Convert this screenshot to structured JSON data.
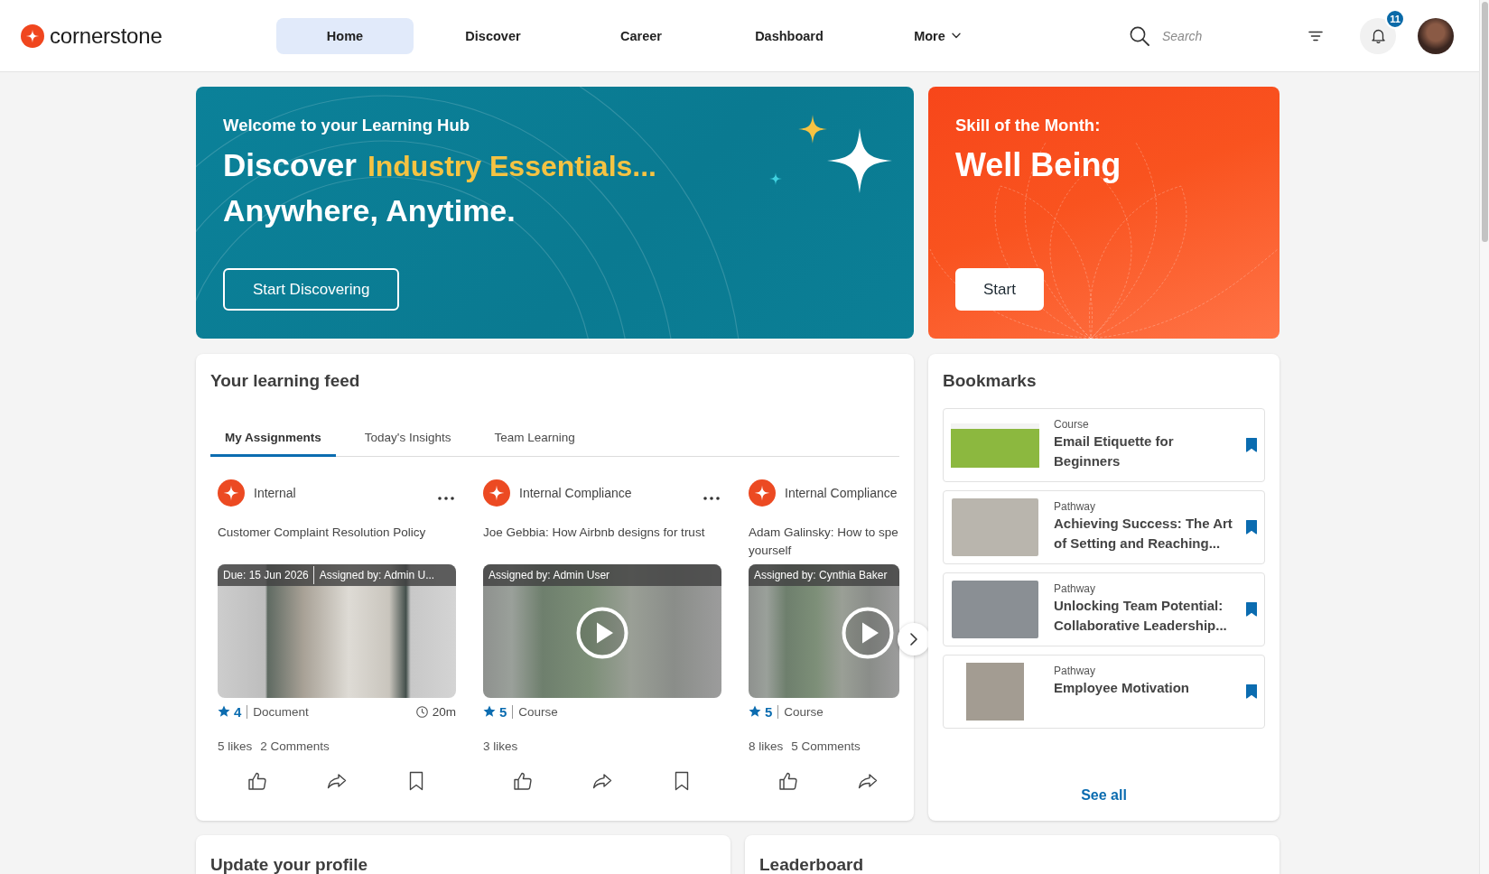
{
  "header": {
    "logo": "cornerstone",
    "nav": [
      {
        "label": "Home",
        "selected": true,
        "has_menu": false
      },
      {
        "label": "Discover",
        "selected": false,
        "has_menu": false
      },
      {
        "label": "Career",
        "selected": false,
        "has_menu": false
      },
      {
        "label": "Dashboard",
        "selected": false,
        "has_menu": false
      },
      {
        "label": "More",
        "selected": false,
        "has_menu": true
      }
    ],
    "search": {
      "placeholder": "Search"
    },
    "notifications": {
      "count": "11"
    }
  },
  "hero": {
    "welcome": {
      "eyebrow": "Welcome to your Learning Hub",
      "headline": "Discover",
      "highlight": "Industry Essentials...",
      "subline": "Anywhere, Anytime.",
      "button": "Start Discovering"
    },
    "skill": {
      "eyebrow": "Skill of the Month:",
      "title": "Well Being",
      "button": "Start"
    }
  },
  "feed": {
    "title": "Your learning feed",
    "tabs": [
      {
        "label": "My Assignments",
        "selected": true
      },
      {
        "label": "Today's Insights",
        "selected": false
      },
      {
        "label": "Team Learning",
        "selected": false
      }
    ],
    "cards": [
      {
        "source": "Internal",
        "menu": true,
        "title_lines": [
          "Customer Complaint Resolution Policy"
        ],
        "media": {
          "kind": "document",
          "captions": [
            "Due: 15 Jun 2026",
            "Assigned by: Admin U..."
          ]
        },
        "rating": "4",
        "type": "Document",
        "duration": "20m",
        "likes": "5 likes",
        "comments": "2 Comments",
        "actions": [
          {
            "kind": "like"
          },
          {
            "kind": "share"
          },
          {
            "kind": "bookmark"
          }
        ]
      },
      {
        "source": "Internal Compliance",
        "menu": true,
        "title_lines": [
          "Joe Gebbia: How Airbnb designs for trust"
        ],
        "media": {
          "kind": "video",
          "captions": [
            "Assigned by: Admin User"
          ]
        },
        "rating": "5",
        "type": "Course",
        "likes": "3 likes",
        "actions": [
          {
            "kind": "like"
          },
          {
            "kind": "share"
          },
          {
            "kind": "bookmark"
          }
        ]
      },
      {
        "source": "Internal Compliance",
        "menu": false,
        "title_lines": [
          "Adam Galinsky: How to spe",
          "yourself"
        ],
        "media": {
          "kind": "video",
          "captions": [
            "Assigned by: Cynthia Baker"
          ]
        },
        "rating": "5",
        "type": "Course",
        "likes": "8 likes",
        "comments": "5 Comments",
        "actions": [
          {
            "kind": "like"
          },
          {
            "kind": "share"
          }
        ]
      }
    ]
  },
  "bookmarks": {
    "title": "Bookmarks",
    "items": [
      {
        "kind": "banner",
        "type": "Course",
        "title": "Email Etiquette for Beginners",
        "bookmarked": true
      },
      {
        "kind": "photo",
        "type": "Pathway",
        "title": "Achieving Success: The Art of Setting and Reaching...",
        "bookmarked": true
      },
      {
        "kind": "photo",
        "type": "Pathway",
        "title": "Unlocking Team Potential: Collaborative Leadership...",
        "bookmarked": true
      },
      {
        "kind": "square",
        "type": "Pathway",
        "title": "Employee Motivation",
        "bookmarked": true
      }
    ],
    "link": "See all"
  },
  "panels": [
    {
      "title": "Update your profile"
    },
    {
      "title": "Leaderboard"
    }
  ]
}
